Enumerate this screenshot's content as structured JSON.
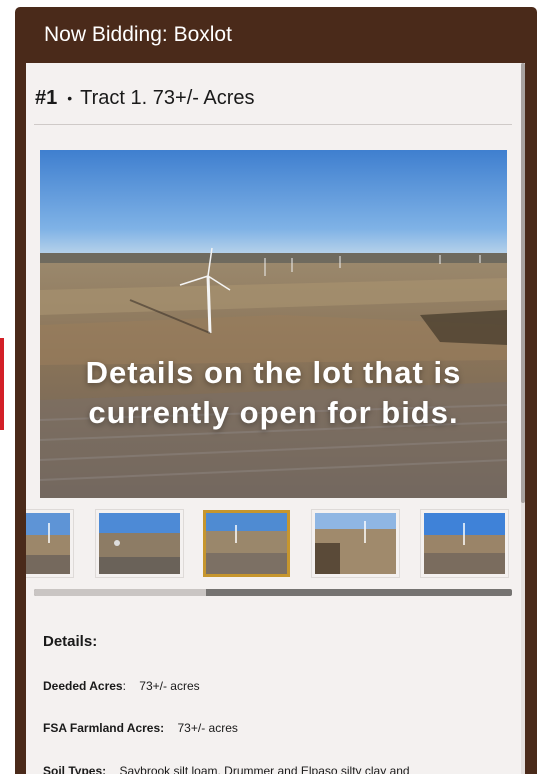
{
  "panel": {
    "title": "Now Bidding: Boxlot"
  },
  "lot": {
    "number": "#1",
    "separator": "•",
    "name": "Tract 1. 73+/- Acres"
  },
  "hero": {
    "caption": "Details on the lot that is currently open for bids."
  },
  "gallery": {
    "thumbnail_count": 5,
    "selected_index": 2,
    "scroll_position_fraction": 0.36
  },
  "details": {
    "heading": "Details:",
    "rows": [
      {
        "label": "Deeded Acres",
        "suffix": ":",
        "value": "73+/- acres"
      },
      {
        "label": "FSA Farmland Acres:",
        "suffix": "",
        "value": "73+/- acres"
      },
      {
        "label": "Soil Types:",
        "suffix": "",
        "value": "Saybrook silt loam, Drummer and Elpaso silty clay and"
      }
    ]
  },
  "colors": {
    "header_brown": "#4a2a1a",
    "card_bg": "#f4f1f0",
    "selected_border": "#c6962e",
    "accent_red": "#d32027"
  }
}
